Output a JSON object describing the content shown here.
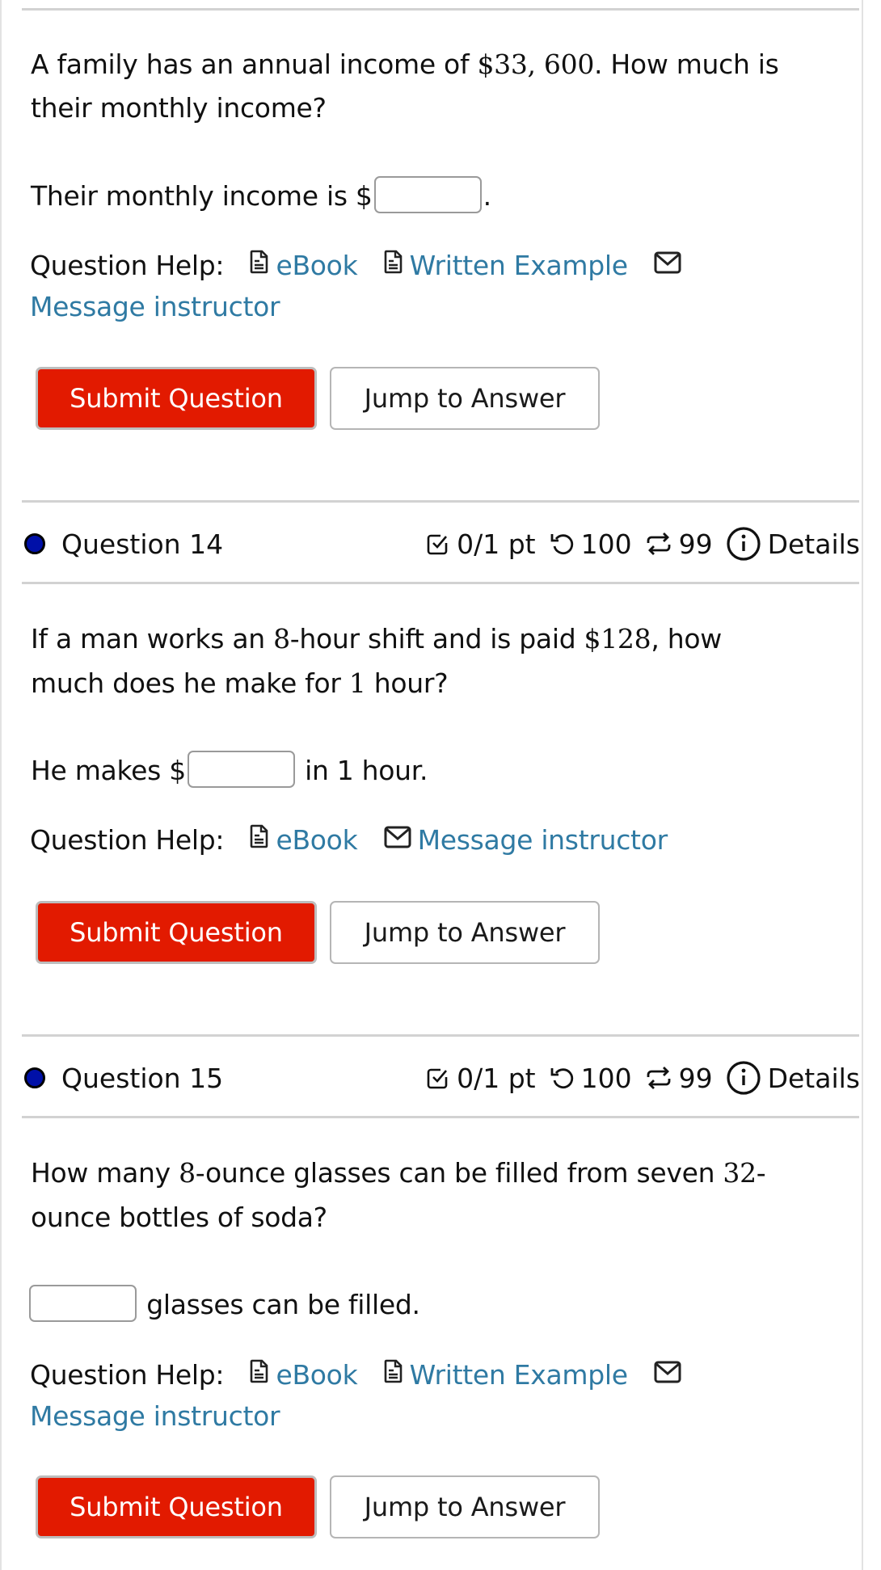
{
  "questions": [
    {
      "id": "q13",
      "text_parts": [
        "A family has an annual income of ",
        "$33, 600",
        ". How much is"
      ],
      "text_line2": "their monthly income?",
      "answer_prefix": "Their monthly income is $",
      "answer_suffix": ".",
      "answer_value": "",
      "help_label": "Question Help:",
      "help_links": [
        {
          "icon": "document-icon",
          "label": "eBook"
        },
        {
          "icon": "document-icon",
          "label": "Written Example"
        },
        {
          "icon": "mail-icon",
          "label": "Message instructor"
        }
      ],
      "submit_label": "Submit Question",
      "jump_label": "Jump to Answer"
    },
    {
      "id": "q14",
      "title": "Question 14",
      "points": "0/1 pt",
      "retries": "100",
      "attempts": "99",
      "details_label": "Details",
      "text_parts": [
        "If a man works an ",
        "8",
        "-hour shift and is paid ",
        "$128",
        ", how"
      ],
      "text_line2_parts": [
        "much does he make for ",
        "1",
        " hour?"
      ],
      "answer_prefix": "He makes $",
      "answer_suffix": "in 1 hour.",
      "answer_value": "",
      "help_label": "Question Help:",
      "help_links": [
        {
          "icon": "document-icon",
          "label": "eBook"
        },
        {
          "icon": "mail-icon",
          "label": "Message instructor"
        }
      ],
      "submit_label": "Submit Question",
      "jump_label": "Jump to Answer"
    },
    {
      "id": "q15",
      "title": "Question 15",
      "points": "0/1 pt",
      "retries": "100",
      "attempts": "99",
      "details_label": "Details",
      "text_parts": [
        "How many ",
        "8",
        "-ounce glasses can be filled from seven ",
        "32",
        "-"
      ],
      "text_line2": "ounce bottles of soda?",
      "answer_prefix": "",
      "answer_suffix": "glasses can be filled.",
      "answer_value": "",
      "help_label": "Question Help:",
      "help_links": [
        {
          "icon": "document-icon",
          "label": "eBook"
        },
        {
          "icon": "document-icon",
          "label": "Written Example"
        },
        {
          "icon": "mail-icon",
          "label": "Message instructor"
        }
      ],
      "submit_label": "Submit Question",
      "jump_label": "Jump to Answer"
    }
  ],
  "colors": {
    "link": "#2f7aa3",
    "submit_bg": "#e21a00",
    "status_dot": "#0010a8"
  }
}
